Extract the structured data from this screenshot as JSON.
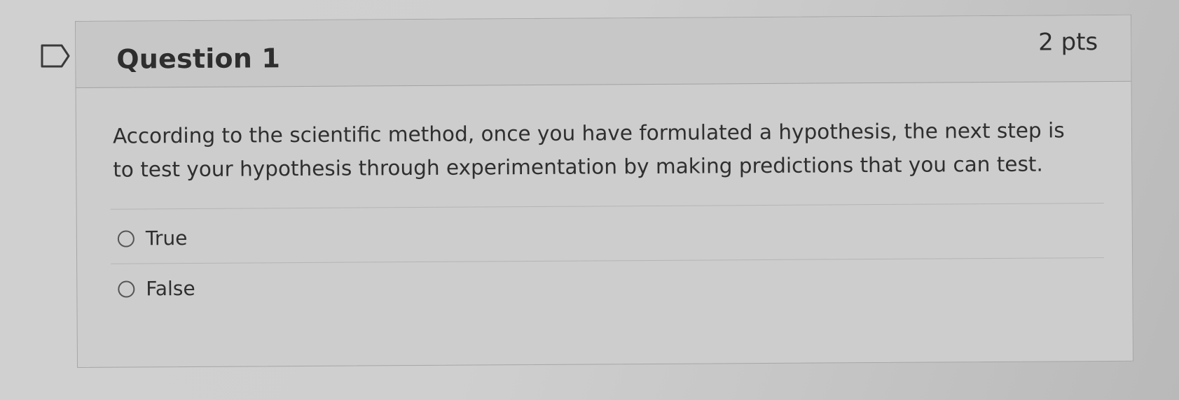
{
  "question": {
    "title": "Question 1",
    "points": "2 pts",
    "text": "According to the scientific method, once you have formulated a hypothesis, the next step is to test your hypothesis through experimentation by making predictions that you can test.",
    "answers": [
      {
        "label": "True"
      },
      {
        "label": "False"
      }
    ]
  },
  "colors": {
    "background": "#cdcdcd",
    "text": "#2f2f2f",
    "border": "#a6a6a6"
  },
  "icons": {
    "flag": "bookmark-flag-icon",
    "radio": "radio-empty-icon"
  }
}
